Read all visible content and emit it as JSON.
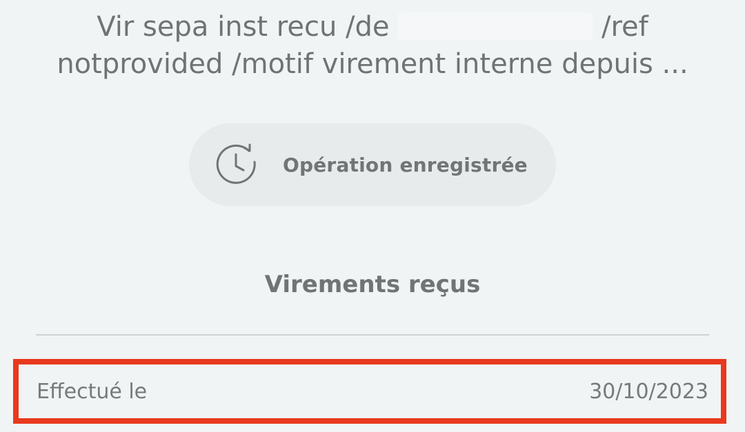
{
  "transaction": {
    "description_part1": "Vir sepa inst recu /de",
    "description_part2": "/ref",
    "description_line2": "notprovided /motif virement interne depuis ..."
  },
  "status": {
    "icon": "clock-history-icon",
    "label": "Opération enregistrée"
  },
  "category": {
    "label": "Virements reçus"
  },
  "details": {
    "rows": [
      {
        "label": "Effectué le",
        "value": "30/10/2023"
      }
    ]
  },
  "colors": {
    "background": "#f1f4f5",
    "pill_background": "#e7ebec",
    "text": "#6f7374",
    "divider": "#cdd2d3",
    "highlight_border": "#e8391d"
  }
}
